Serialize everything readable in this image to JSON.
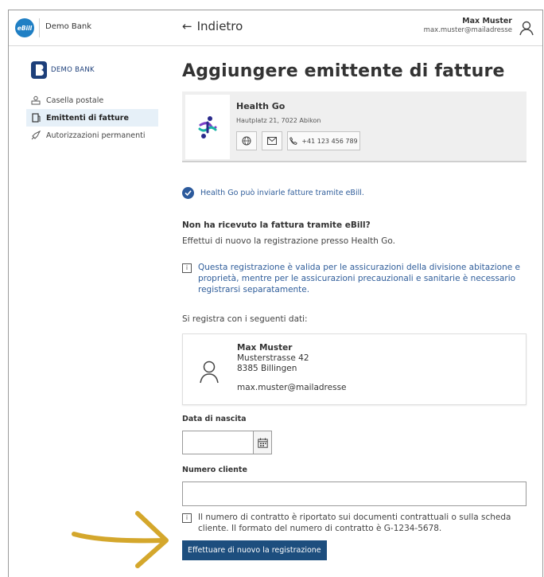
{
  "topbar": {
    "ebill_logo": "eBill",
    "bank_name": "Demo Bank",
    "back_label": "Indietro",
    "user_name": "Max Muster",
    "user_email": "max.muster@mailadresse"
  },
  "sidebar": {
    "logo_text": "DEMO BANK",
    "items": [
      {
        "label": "Casella postale",
        "icon": "mailbox-icon",
        "active": false
      },
      {
        "label": "Emittenti di fatture",
        "icon": "document-icon",
        "active": true
      },
      {
        "label": "Autorizzazioni permanenti",
        "icon": "rocket-icon",
        "active": false
      }
    ]
  },
  "main": {
    "title": "Aggiungere emittente di fatture",
    "issuer": {
      "name": "Health Go",
      "address": "Hautplatz 21, 7022 Abikon",
      "phone": "+41 123 456 789"
    },
    "status_text": "Health Go può inviarle fatture tramite eBill.",
    "question_title": "Non ha ricevuto la fattura tramite eBill?",
    "question_text": "Effettui di nuovo la registrazione presso Health Go.",
    "info_1": "Questa registrazione è valida per le assicurazioni della divisione abitazione e proprietà, mentre per le assicurazioni precauzionali e sanitarie è necessario registrarsi separatamente.",
    "data_intro": "Si registra con i seguenti dati:",
    "person": {
      "name": "Max Muster",
      "street": "Musterstrasse 42",
      "city": "8385 Billingen",
      "email": "max.muster@mailadresse"
    },
    "birthdate_label": "Data di nascita",
    "birthdate_value": "",
    "client_number_label": "Numero cliente",
    "client_number_value": "",
    "info_2": "Il numero di contratto è riportato sui documenti contrattuali o sulla scheda cliente. Il formato del numero di contratto è G-1234-5678.",
    "submit_label": "Effettuare di nuovo la registrazione"
  },
  "colors": {
    "accent": "#1d4e7e",
    "link_blue": "#2f5d9a",
    "ebill_blue": "#1f7fc4",
    "arrow_gold": "#d4a72c"
  }
}
